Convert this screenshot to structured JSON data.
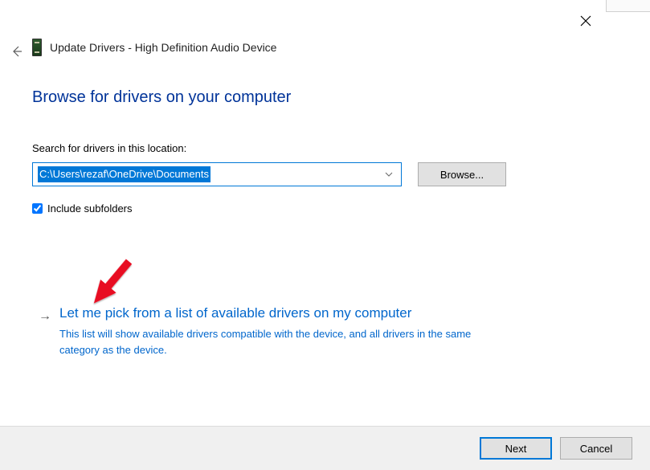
{
  "window": {
    "title": "Update Drivers - High Definition Audio Device"
  },
  "main": {
    "heading": "Browse for drivers on your computer",
    "search_label": "Search for drivers in this location:",
    "path_value": "C:\\Users\\rezaf\\OneDrive\\Documents",
    "browse_label": "Browse...",
    "include_subfolders_label": "Include subfolders",
    "include_subfolders_checked": true
  },
  "option": {
    "title": "Let me pick from a list of available drivers on my computer",
    "description": "This list will show available drivers compatible with the device, and all drivers in the same category as the device."
  },
  "footer": {
    "next_label": "Next",
    "cancel_label": "Cancel"
  }
}
